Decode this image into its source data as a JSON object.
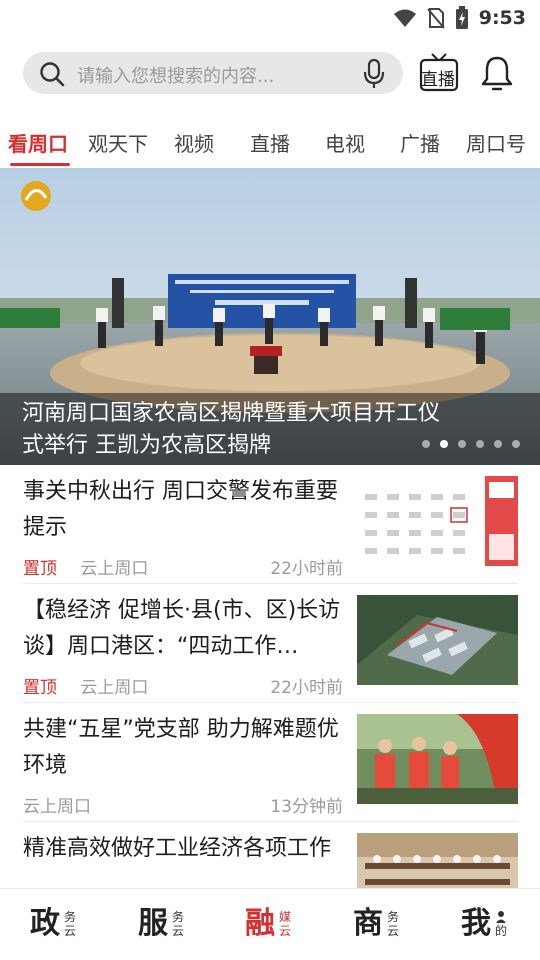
{
  "status_bar": {
    "time": "9:53",
    "icons": [
      "wifi-icon",
      "no-sim-icon",
      "battery-charging-icon"
    ]
  },
  "search": {
    "placeholder": "请输入您想搜索的内容..."
  },
  "header": {
    "tv_label": "直播"
  },
  "tabs": [
    {
      "label": "看周口",
      "active": true
    },
    {
      "label": "观天下"
    },
    {
      "label": "视频"
    },
    {
      "label": "直播"
    },
    {
      "label": "电视"
    },
    {
      "label": "广播"
    },
    {
      "label": "周口号"
    }
  ],
  "hero": {
    "caption": "河南周口国家农高区揭牌暨重大项目开工仪式举行 王凯为农高区揭牌",
    "dots": 6,
    "active_dot": 1
  },
  "news": [
    {
      "title": "事关中秋出行 周口交警发布重要提示",
      "pinned": "置顶",
      "source": "云上周口",
      "time": "22小时前",
      "thumb": "calendar"
    },
    {
      "title": "【稳经济 促增长·县(市、区)长访谈】周口港区：“四动工作…",
      "pinned": "置顶",
      "source": "云上周口",
      "time": "22小时前",
      "thumb": "aerial"
    },
    {
      "title": "共建“五星”党支部 助力解难题优环境",
      "pinned": "",
      "source": "云上周口",
      "time": "13分钟前",
      "thumb": "volunteers"
    },
    {
      "title": "精准高效做好工业经济各项工作",
      "pinned": "",
      "source": "",
      "time": "",
      "thumb": "meeting"
    }
  ],
  "bottom_nav": [
    {
      "big": "政",
      "small1": "务",
      "small2": "云",
      "active": false
    },
    {
      "big": "服",
      "small1": "务",
      "small2": "云",
      "active": false
    },
    {
      "big": "融",
      "small1": "媒",
      "small2": "云",
      "active": true
    },
    {
      "big": "商",
      "small1": "务",
      "small2": "云",
      "active": false
    },
    {
      "big": "我",
      "small1": "",
      "small2": "的",
      "active": false
    }
  ],
  "colors": {
    "accent": "#d72f2f",
    "search_bg": "#e7e7e7"
  }
}
